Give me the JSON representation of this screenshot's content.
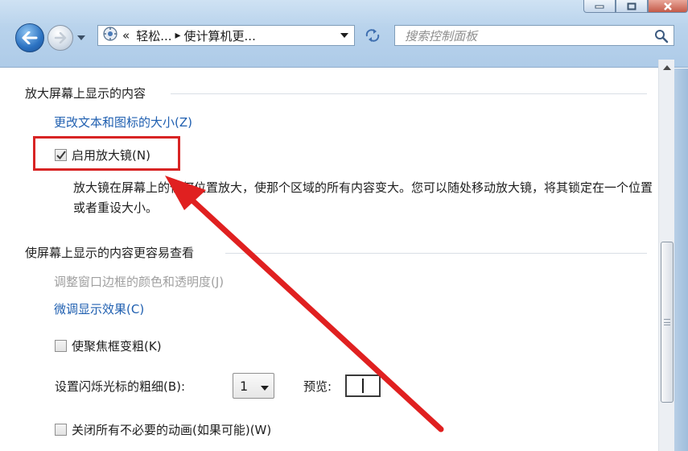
{
  "window": {
    "caption_buttons": [
      "minimize-icon",
      "maximize-icon",
      "close-icon"
    ]
  },
  "navigation": {
    "back_icon": "back-arrow-icon",
    "forward_icon": "forward-arrow-icon",
    "history_icon": "chevron-down-icon",
    "address": {
      "icon": "control-panel-icon",
      "overflow": "«",
      "crumbs": [
        "轻松...",
        "使计算机更..."
      ],
      "separator": "▸"
    },
    "refresh_icon": "refresh-icon",
    "search": {
      "placeholder": "搜索控制面板",
      "icon": "search-icon"
    }
  },
  "sections": {
    "magnify": {
      "title": "放大屏幕上显示的内容",
      "link_text_size": "更改文本和图标的大小(Z)",
      "enable_magnifier": {
        "label": "启用放大镜(N)",
        "checked": true
      },
      "description": "放大镜在屏幕上的任何位置放大，使那个区域的所有内容变大。您可以随处移动放大镜，将其锁定在一个位置或者重设大小。"
    },
    "easier_to_see": {
      "title": "使屏幕上显示的内容更容易查看",
      "link_border_color": "调整窗口边框的颜色和透明度(J)",
      "link_display_effect": "微调显示效果(C)",
      "thicken_focus": {
        "label": "使聚焦框变粗(K)",
        "checked": false
      },
      "cursor_thickness": {
        "label": "设置闪烁光标的粗细(B):",
        "value": "1",
        "preview_label": "预览:"
      },
      "disable_animations": {
        "label": "关闭所有不必要的动画(如果可能)(W)",
        "checked": false
      }
    }
  },
  "colors": {
    "link": "#1f5fb0",
    "highlight": "#d82424",
    "annotation_arrow": "#e02020"
  }
}
